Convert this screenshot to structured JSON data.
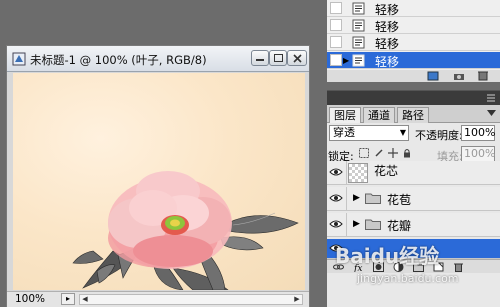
{
  "document": {
    "title": "未标题-1 @ 100% (叶子, RGB/8)",
    "zoom": "100%"
  },
  "history": {
    "items": [
      {
        "label": "轻移",
        "selected": false
      },
      {
        "label": "轻移",
        "selected": false
      },
      {
        "label": "轻移",
        "selected": false
      },
      {
        "label": "轻移",
        "selected": true
      }
    ]
  },
  "layers_panel": {
    "tabs": [
      "图层",
      "通道",
      "路径"
    ],
    "active_tab": "图层",
    "blend_mode": "穿透",
    "opacity_label": "不透明度:",
    "opacity_value": "100%",
    "lock_label": "锁定:",
    "fill_label": "填充:",
    "fill_value": "100%",
    "layers": [
      {
        "name": "花芯",
        "type": "layer",
        "visible": true,
        "selected": false
      },
      {
        "name": "花苞",
        "type": "group",
        "visible": true,
        "selected": false
      },
      {
        "name": "花瓣",
        "type": "group",
        "visible": true,
        "selected": false
      },
      {
        "name": "",
        "type": "group",
        "visible": true,
        "selected": true
      }
    ]
  },
  "watermark": {
    "brand": "Baidu经验",
    "url": "jingyan.baidu.com"
  },
  "colors": {
    "selection": "#2b6ad8",
    "canvas_bg": "#fbe6c8"
  }
}
